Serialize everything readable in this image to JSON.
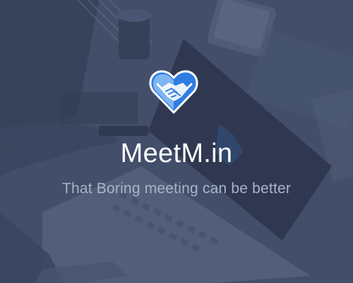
{
  "app": {
    "title": "MeetM.in",
    "tagline": "That Boring meeting can be better",
    "logo_icon": "handshake-heart-icon"
  },
  "colors": {
    "overlay": "#3f4a65",
    "title": "#ffffff",
    "tagline": "#aab4c8",
    "logo_blue": "#2f7de1",
    "logo_light": "#7fb6f2"
  }
}
